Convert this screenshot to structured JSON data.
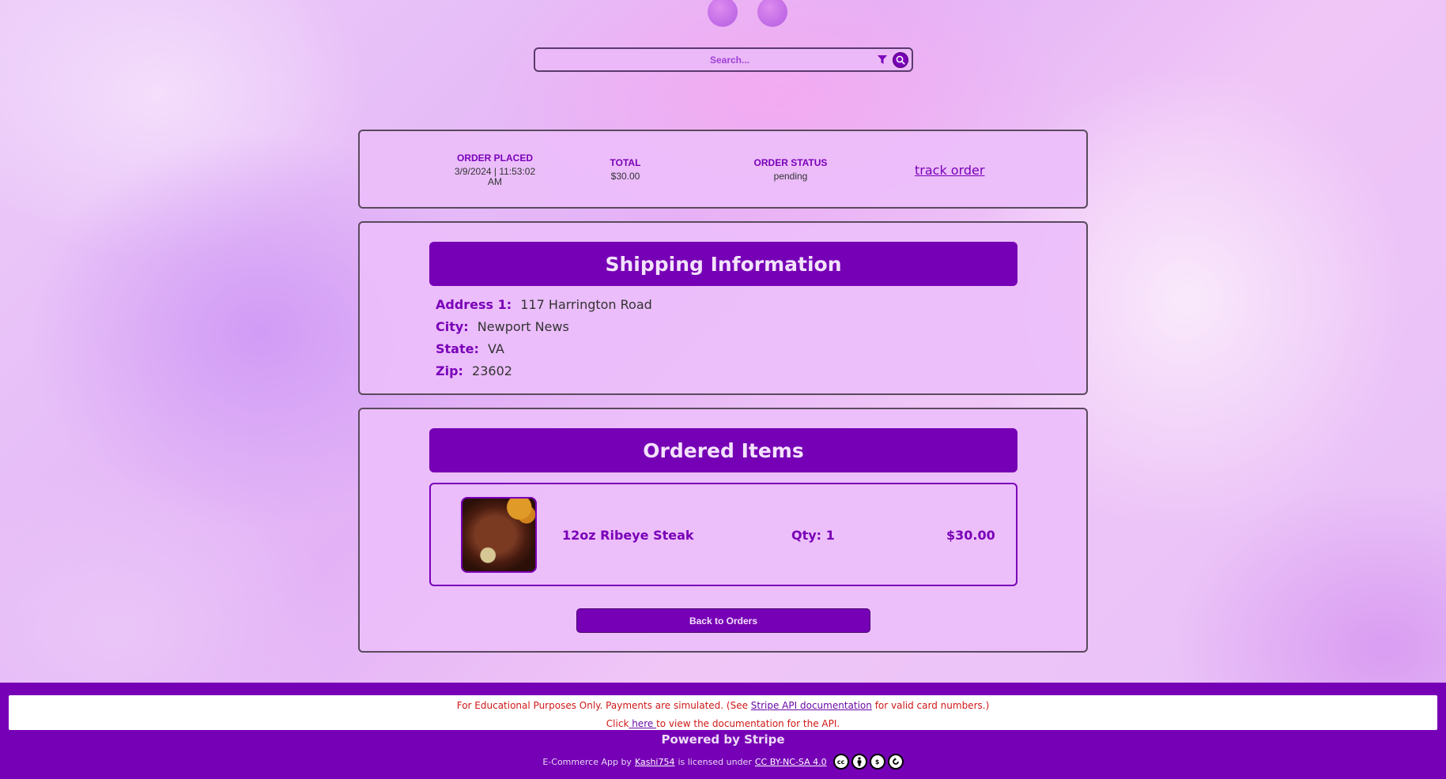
{
  "search": {
    "placeholder": "Search..."
  },
  "order_summary": {
    "placed_label": "ORDER PLACED",
    "placed_value": "3/9/2024 | 11:53:02 AM",
    "total_label": "TOTAL",
    "total_value": "$30.00",
    "status_label": "ORDER STATUS",
    "status_value": "pending",
    "track_label": "track order"
  },
  "shipping": {
    "title": "Shipping Information",
    "rows": [
      {
        "label": "Address 1:",
        "value": "117 Harrington Road"
      },
      {
        "label": "City:",
        "value": "Newport News"
      },
      {
        "label": "State:",
        "value": "VA"
      },
      {
        "label": "Zip:",
        "value": "23602"
      }
    ]
  },
  "items": {
    "title": "Ordered Items",
    "list": [
      {
        "name": "12oz Ribeye Steak",
        "qty": "Qty: 1",
        "price": "$30.00",
        "image": "ribeye-steak-photo"
      }
    ],
    "back_label": "Back to Orders"
  },
  "footer": {
    "notice_pre": "For Educational Purposes Only. Payments are simulated. (See ",
    "notice_link": "Stripe API documentation",
    "notice_post": " for valid card numbers.)",
    "click_pre": "Click",
    "click_link": " here ",
    "click_post": "to view the documentation for the API.",
    "powered": "Powered by Stripe",
    "license_pre": "E-Commerce App by",
    "author": " Kashi754",
    "license_mid": " is licensed under ",
    "license_link": "CC BY-NC-SA 4.0",
    "cc_icons": [
      "cc-icon",
      "by-icon",
      "nc-icon",
      "sa-icon"
    ]
  },
  "colors": {
    "accent": "#7600b5",
    "notice_text": "#d01818"
  }
}
